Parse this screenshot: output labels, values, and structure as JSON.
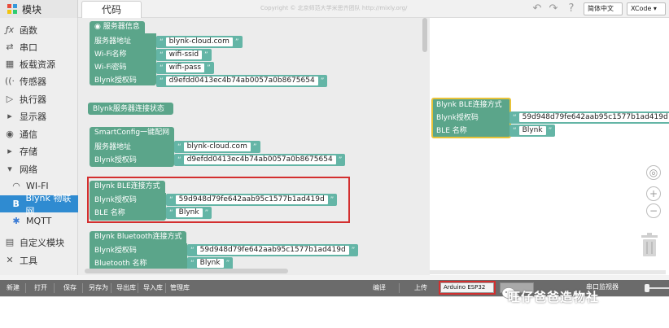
{
  "topbar": {
    "modules_label": "模块",
    "code_tab": "代码",
    "copyright": "Copyright © 北京师范大学米思齐团队 http://mixly.org/",
    "language": "简体中文 ▾",
    "theme": "XCode ▾"
  },
  "sidebar": {
    "items": [
      {
        "label": "函数",
        "icon": "fx-icon"
      },
      {
        "label": "串口",
        "icon": "serial-icon"
      },
      {
        "label": "板载资源",
        "icon": "board-icon"
      },
      {
        "label": "传感器",
        "icon": "sensor-icon"
      },
      {
        "label": "执行器",
        "icon": "actuator-icon"
      },
      {
        "label": "显示器",
        "icon": "display-icon"
      },
      {
        "label": "通信",
        "icon": "communication-icon"
      },
      {
        "label": "存储",
        "icon": "storage-icon"
      },
      {
        "label": "网络",
        "icon": "network-icon"
      },
      {
        "label": "WI-FI",
        "icon": "wifi-icon"
      },
      {
        "label": "Blynk 物联网",
        "icon": "blynk-icon"
      },
      {
        "label": "MQTT",
        "icon": "mqtt-icon"
      },
      {
        "label": "自定义模块",
        "icon": "custom-module-icon"
      },
      {
        "label": "工具",
        "icon": "tools-icon"
      }
    ]
  },
  "blocks": {
    "server_info": {
      "title": "服务器信息",
      "rows": [
        {
          "label": "服务器地址",
          "value": "blynk-cloud.com"
        },
        {
          "label": "Wi-Fi名称",
          "value": "wifi-ssid"
        },
        {
          "label": "Wi-Fi密码",
          "value": "wifi-pass"
        },
        {
          "label": "Blynk授权码",
          "value": "d9efdd0413ec4b74ab0057a0b8675654"
        }
      ]
    },
    "server_status": {
      "title": "Blynk服务器连接状态"
    },
    "smartconfig": {
      "title": "SmartConfig一键配网",
      "rows": [
        {
          "label": "服务器地址",
          "value": "blynk-cloud.com"
        },
        {
          "label": "Blynk授权码",
          "value": "d9efdd0413ec4b74ab0057a0b8675654"
        }
      ]
    },
    "ble": {
      "title": "Blynk BLE连接方式",
      "rows": [
        {
          "label": "Blynk授权码",
          "value": "59d948d79fe642aab95c1577b1ad419d"
        },
        {
          "label": "BLE  名称",
          "value": "Blynk"
        }
      ]
    },
    "bluetooth": {
      "title": "Blynk Bluetooth连接方式",
      "rows": [
        {
          "label": "Blynk授权码",
          "value": "59d948d79fe642aab95c1577b1ad419d"
        },
        {
          "label": "Bluetooth  名称",
          "value": "Blynk"
        }
      ]
    },
    "ble_placed": {
      "title": "Blynk BLE连接方式",
      "rows": [
        {
          "label": "Blynk授权码",
          "value": "59d948d79fe642aab95c1577b1ad419d"
        },
        {
          "label": "BLE  名称",
          "value": "Blynk"
        }
      ]
    }
  },
  "bottombar": {
    "new": "新建",
    "open": "打开",
    "save": "保存",
    "save_as": "另存为",
    "export_lib": "导出库",
    "import_lib": "导入库",
    "manage_lib": "管理库",
    "compile": "编译",
    "upload": "上传",
    "board": "Arduino ESP32",
    "monitor": "串口监视器"
  },
  "watermark": "旺仔爸爸造物社",
  "colors": {
    "block": "#5ba58a",
    "value": "#64b5a6",
    "highlight": "#d32f2f",
    "active_category": "#2f8bd1",
    "placed_block_border": "#e8c33a"
  }
}
